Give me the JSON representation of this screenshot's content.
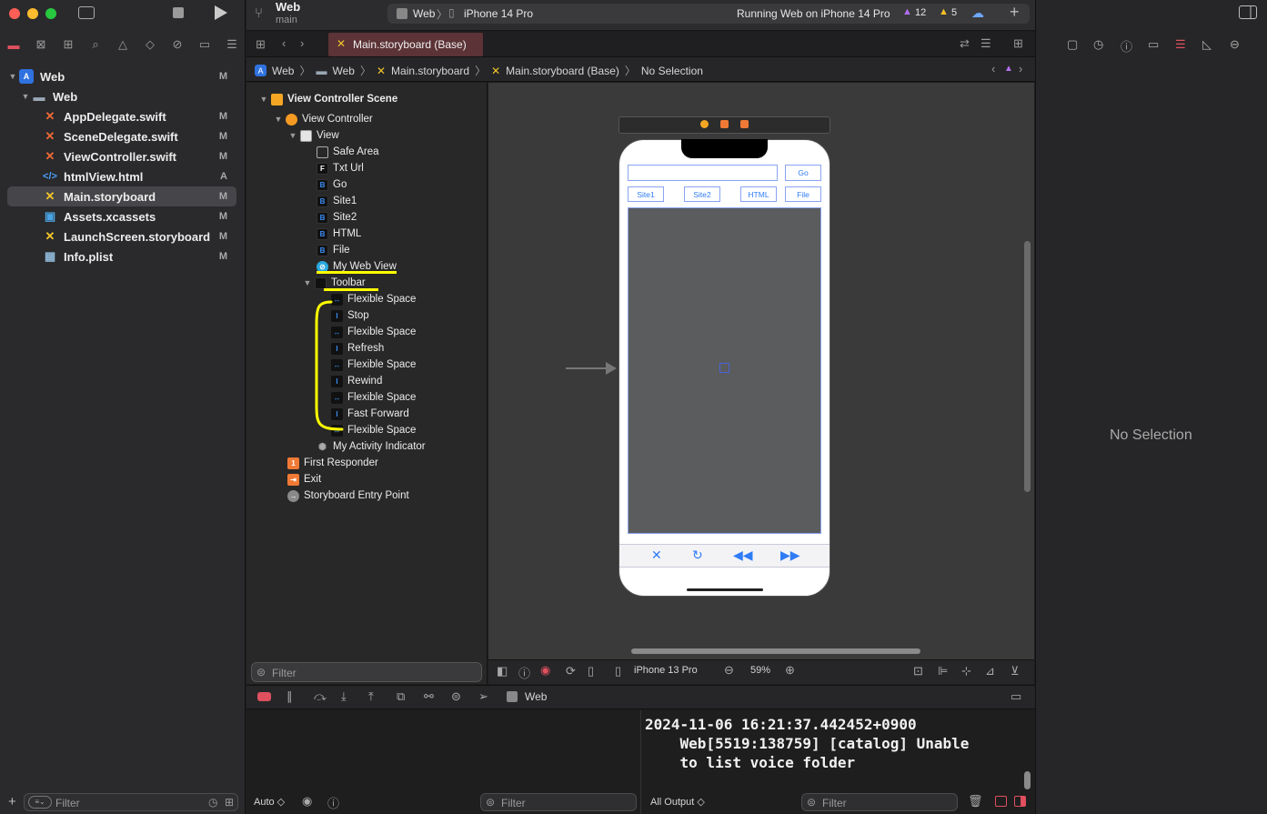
{
  "window": {
    "project_name": "Web",
    "branch": "main",
    "scheme": "Web",
    "destination": "iPhone 14 Pro",
    "activity_status": "Running Web on iPhone 14 Pro",
    "warnings_purple": "12",
    "warnings_yellow": "5"
  },
  "colors": {
    "accent": "#2f7cf6",
    "close": "#ff5f57",
    "minimize": "#febc2e",
    "zoom": "#28c840",
    "annotation": "#ffff00"
  },
  "navigator": {
    "items": [
      {
        "label": "Web",
        "status": "M",
        "icon": "app-icon"
      },
      {
        "label": "Web",
        "status": "",
        "icon": "folder-icon"
      },
      {
        "label": "AppDelegate.swift",
        "status": "M",
        "icon": "swift-icon"
      },
      {
        "label": "SceneDelegate.swift",
        "status": "M",
        "icon": "swift-icon"
      },
      {
        "label": "ViewController.swift",
        "status": "M",
        "icon": "swift-icon"
      },
      {
        "label": "htmlView.html",
        "status": "A",
        "icon": "html-icon"
      },
      {
        "label": "Main.storyboard",
        "status": "M",
        "icon": "storyboard-icon"
      },
      {
        "label": "Assets.xcassets",
        "status": "M",
        "icon": "assets-icon"
      },
      {
        "label": "LaunchScreen.storyboard",
        "status": "M",
        "icon": "storyboard-icon"
      },
      {
        "label": "Info.plist",
        "status": "M",
        "icon": "plist-icon"
      }
    ],
    "filter_placeholder": "Filter"
  },
  "editor": {
    "tab_label": "Main.storyboard (Base)",
    "breadcrumb": [
      "Web",
      "Web",
      "Main.storyboard",
      "Main.storyboard (Base)",
      "No Selection"
    ]
  },
  "outline": {
    "items": [
      {
        "label": "View Controller Scene",
        "icon": "scene-icon"
      },
      {
        "label": "View Controller",
        "icon": "view-controller-icon"
      },
      {
        "label": "View",
        "icon": "view-icon"
      },
      {
        "label": "Safe Area",
        "icon": "safe-area-icon"
      },
      {
        "label": "Txt Url",
        "icon": "textfield-icon",
        "glyph": "F"
      },
      {
        "label": "Go",
        "icon": "button-icon",
        "glyph": "B"
      },
      {
        "label": "Site1",
        "icon": "button-icon",
        "glyph": "B"
      },
      {
        "label": "Site2",
        "icon": "button-icon",
        "glyph": "B"
      },
      {
        "label": "HTML",
        "icon": "button-icon",
        "glyph": "B"
      },
      {
        "label": "File",
        "icon": "button-icon",
        "glyph": "B"
      },
      {
        "label": "My Web View",
        "icon": "webview-icon"
      },
      {
        "label": "Toolbar",
        "icon": "toolbar-icon"
      },
      {
        "label": "Flexible Space",
        "icon": "flexible-space-icon"
      },
      {
        "label": "Stop",
        "icon": "bar-item-icon"
      },
      {
        "label": "Flexible Space",
        "icon": "flexible-space-icon"
      },
      {
        "label": "Refresh",
        "icon": "bar-item-icon"
      },
      {
        "label": "Flexible Space",
        "icon": "flexible-space-icon"
      },
      {
        "label": "Rewind",
        "icon": "bar-item-icon"
      },
      {
        "label": "Flexible Space",
        "icon": "flexible-space-icon"
      },
      {
        "label": "Fast Forward",
        "icon": "bar-item-icon"
      },
      {
        "label": "Flexible Space",
        "icon": "flexible-space-icon"
      },
      {
        "label": "My Activity Indicator",
        "icon": "activity-indicator-icon"
      },
      {
        "label": "First Responder",
        "icon": "first-responder-icon"
      },
      {
        "label": "Exit",
        "icon": "exit-icon"
      },
      {
        "label": "Storyboard Entry Point",
        "icon": "entry-point-icon"
      }
    ],
    "filter_placeholder": "Filter"
  },
  "device": {
    "buttons": [
      "Go",
      "Site1",
      "Site2",
      "HTML",
      "File"
    ],
    "toolbar_icons": [
      "stop-icon",
      "refresh-icon",
      "rewind-icon",
      "fast-forward-icon"
    ]
  },
  "canvas_bar": {
    "device": "iPhone 13 Pro",
    "zoom": "59%"
  },
  "debug": {
    "target": "Web",
    "vars_mode": "Auto ◇",
    "vars_filter_placeholder": "Filter",
    "output_mode": "All Output ◇",
    "console_filter_placeholder": "Filter",
    "console_lines": [
      "2024-11-06 16:21:37.442452+0900",
      "    Web[5519:138759] [catalog] Unable",
      "    to list voice folder"
    ]
  },
  "inspector": {
    "empty_label": "No Selection"
  }
}
